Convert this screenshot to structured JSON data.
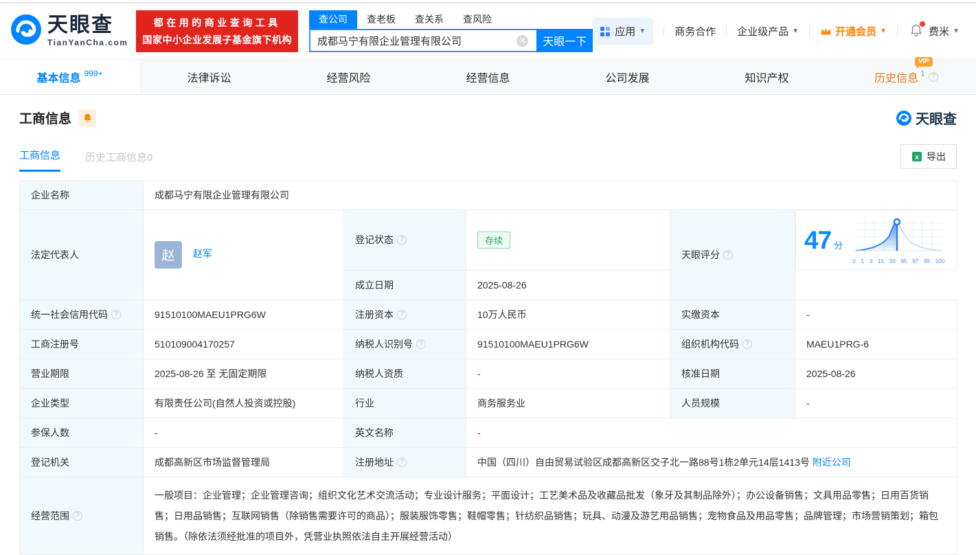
{
  "header": {
    "logo": {
      "brand": "天眼查",
      "domain": "TianYanCha.com"
    },
    "banner": {
      "line1": "都在用的商业查询工具",
      "line2": "国家中小企业发展子基金旗下机构"
    },
    "search": {
      "tabs": [
        "查公司",
        "查老板",
        "查关系",
        "查风险"
      ],
      "active_tab": "查公司",
      "input_value": "成都马宁有限企业管理有限公司",
      "button": "天眼一下"
    },
    "nav": {
      "apps": "应用",
      "cooperation": "商务合作",
      "enterprise": "企业级产品",
      "vip": "开通会员",
      "username": "费米"
    }
  },
  "tabs": [
    {
      "label": "基本信息",
      "badge": "999+"
    },
    {
      "label": "法律诉讼"
    },
    {
      "label": "经营风险"
    },
    {
      "label": "经营信息"
    },
    {
      "label": "公司发展"
    },
    {
      "label": "知识产权"
    },
    {
      "label": "历史信息",
      "vip": "VIP",
      "count": "1"
    }
  ],
  "section": {
    "title": "工商信息",
    "subtab_active": "工商信息",
    "subtab_history": "历史工商信息0",
    "export_label": "导出",
    "watermark": "天眼查"
  },
  "info": {
    "company_name": {
      "label": "企业名称",
      "value": "成都马宁有限企业管理有限公司"
    },
    "legal_rep": {
      "label": "法定代表人",
      "avatar_char": "赵",
      "name": "赵军"
    },
    "reg_status": {
      "label": "登记状态",
      "value": "存续"
    },
    "establish_date": {
      "label": "成立日期",
      "value": "2025-08-26"
    },
    "score": {
      "label": "天眼评分",
      "value": "47",
      "unit": "分",
      "ticks": [
        "0",
        "1",
        "3",
        "15",
        "50",
        "85",
        "97",
        "99",
        "100"
      ]
    },
    "credit_code": {
      "label": "统一社会信用代码",
      "value": "91510100MAEU1PRG6W"
    },
    "reg_capital": {
      "label": "注册资本",
      "value": "10万人民币"
    },
    "paid_capital": {
      "label": "实缴资本",
      "value": "-"
    },
    "reg_number": {
      "label": "工商注册号",
      "value": "510109004170257"
    },
    "taxpayer_id": {
      "label": "纳税人识别号",
      "value": "91510100MAEU1PRG6W"
    },
    "org_code": {
      "label": "组织机构代码",
      "value": "MAEU1PRG-6"
    },
    "business_term": {
      "label": "营业期限",
      "value": "2025-08-26 至 无固定期限"
    },
    "taxpayer_quality": {
      "label": "纳税人资质",
      "value": "-"
    },
    "approval_date": {
      "label": "核准日期",
      "value": "2025-08-26"
    },
    "company_type": {
      "label": "企业类型",
      "value": "有限责任公司(自然人投资或控股)"
    },
    "industry": {
      "label": "行业",
      "value": "商务服务业"
    },
    "staff_size": {
      "label": "人员规模",
      "value": "-"
    },
    "insured_count": {
      "label": "参保人数",
      "value": "-"
    },
    "english_name": {
      "label": "英文名称",
      "value": "-"
    },
    "reg_authority": {
      "label": "登记机关",
      "value": "成都高新区市场监督管理局"
    },
    "reg_address": {
      "label": "注册地址",
      "value": "中国（四川）自由贸易试验区成都高新区交子北一路88号1栋2单元14层1413号",
      "link": "附近公司"
    },
    "business_scope": {
      "label": "经营范围",
      "value": "一般项目：企业管理；企业管理咨询；组织文化艺术交流活动；专业设计服务；平面设计；工艺美术品及收藏品批发（象牙及其制品除外）；办公设备销售；文具用品零售；日用百货销售；日用品销售；互联网销售（除销售需要许可的商品）；服装服饰零售；鞋帽零售；针纺织品销售；玩具、动漫及游艺用品销售；宠物食品及用品零售；品牌管理；市场营销策划；箱包销售。（除依法须经批准的项目外，凭营业执照依法自主开展经营活动）"
    }
  },
  "colors": {
    "brand_blue": "#0084ff",
    "banner_red": "#e2241e",
    "vip_orange": "#ff7d00",
    "status_green": "#2daa5e",
    "score_blue": "#0b8bff"
  }
}
